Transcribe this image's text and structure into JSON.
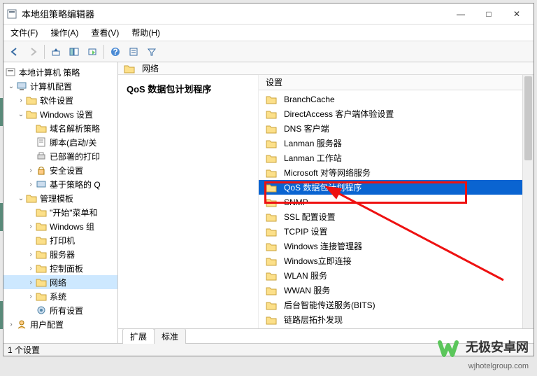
{
  "window": {
    "title": "本地组策略编辑器",
    "minimize": "—",
    "maximize": "□",
    "close": "✕"
  },
  "menu": {
    "file": "文件(F)",
    "action": "操作(A)",
    "view": "查看(V)",
    "help": "帮助(H)"
  },
  "tree": {
    "root": "本地计算机 策略",
    "computer_config": "计算机配置",
    "software_settings": "软件设置",
    "windows_settings": "Windows 设置",
    "dns_policy": "域名解析策略",
    "scripts": "脚本(启动/关",
    "deployed_printers": "已部署的打印",
    "security_settings": "安全设置",
    "policy_based_qos": "基于策略的 Q",
    "admin_templates": "管理模板",
    "start_menu": "\"开始\"菜单和",
    "windows_components": "Windows 组",
    "printers": "打印机",
    "servers": "服务器",
    "control_panel": "控制面板",
    "network": "网络",
    "system": "系统",
    "all_settings": "所有设置",
    "user_config": "用户配置"
  },
  "path": {
    "current": "网络"
  },
  "detail": {
    "header": "QoS 数据包计划程序"
  },
  "column": {
    "setting": "设置"
  },
  "list": {
    "items": [
      "BranchCache",
      "DirectAccess 客户端体验设置",
      "DNS 客户端",
      "Lanman 服务器",
      "Lanman 工作站",
      "Microsoft 对等网络服务",
      "QoS 数据包计划程序",
      "SNMP",
      "SSL 配置设置",
      "TCPIP 设置",
      "Windows 连接管理器",
      "Windows立即连接",
      "WLAN 服务",
      "WWAN 服务",
      "后台智能传送服务(BITS)",
      "链路层拓扑发现"
    ],
    "selected_index": 6
  },
  "tabs": {
    "extended": "扩展",
    "standard": "标准"
  },
  "status": {
    "text": "1 个设置"
  },
  "watermark": {
    "line1": "无极安卓网",
    "line2": "wjhotelgroup.com"
  }
}
